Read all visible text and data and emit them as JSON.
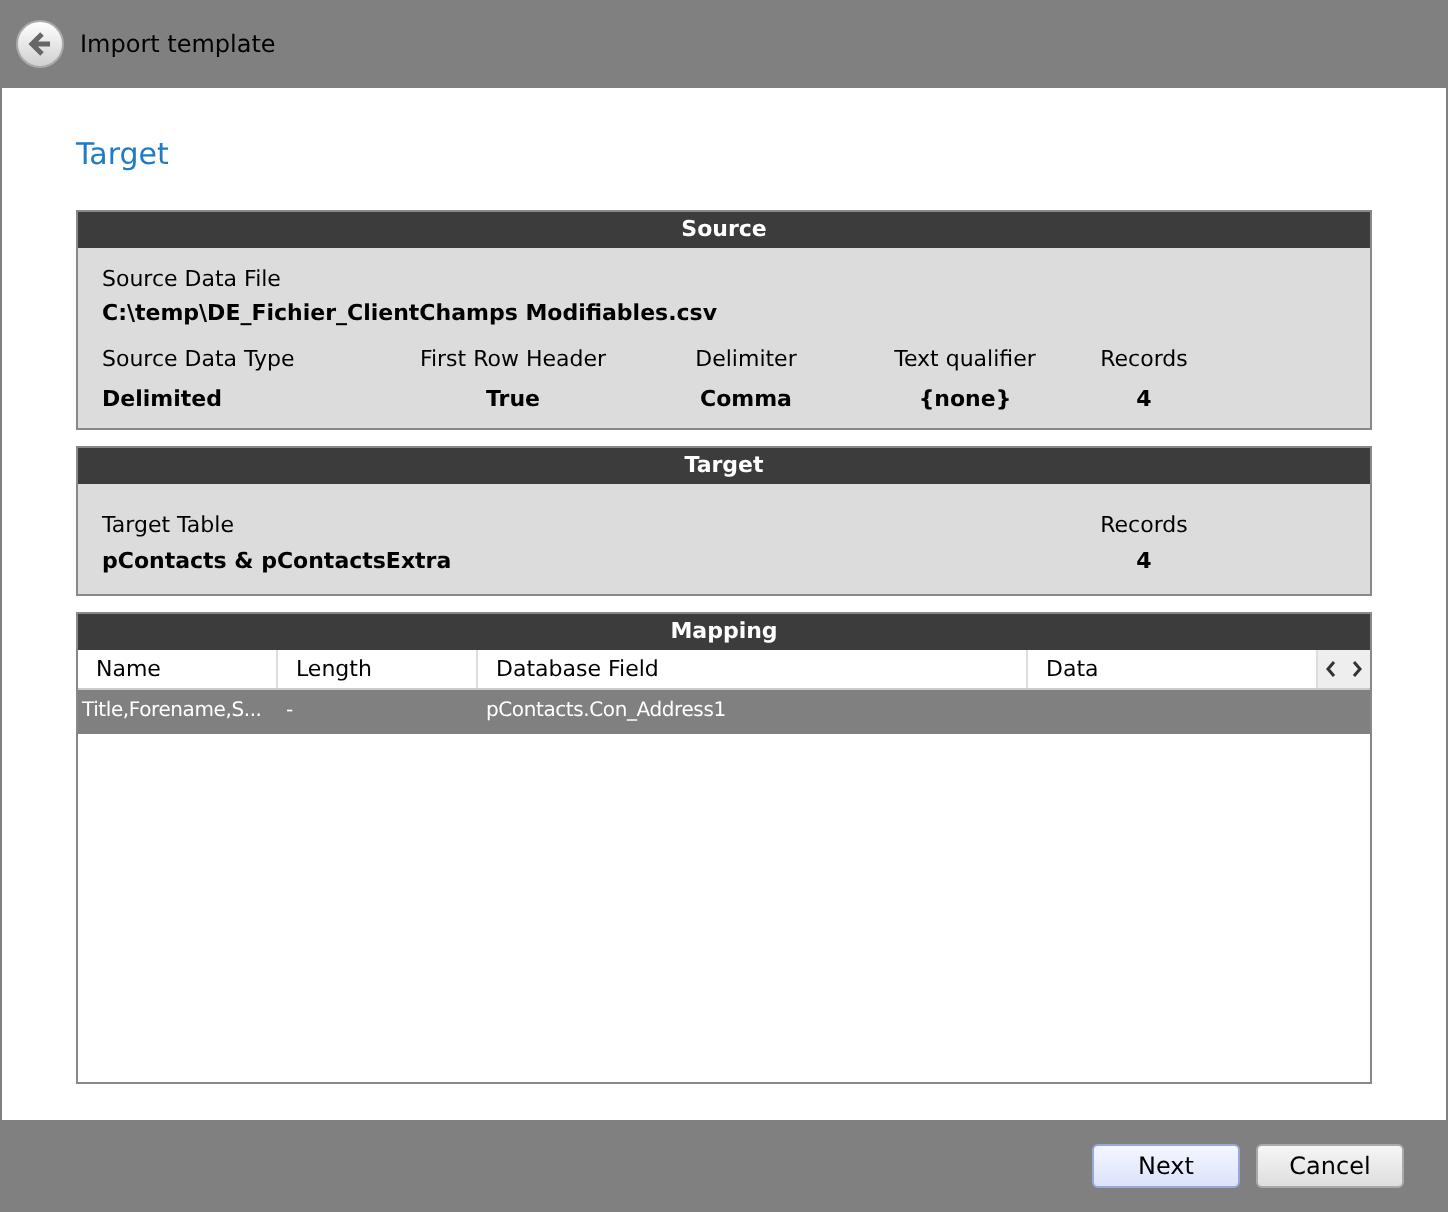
{
  "window": {
    "title": "Import template"
  },
  "page_title": "Target",
  "source": {
    "title": "Source",
    "file_label": "Source Data File",
    "file_value": "C:\\temp\\DE_Fichier_ClientChamps Modifiables.csv",
    "fields": [
      {
        "label": "Source Data Type",
        "value": "Delimited"
      },
      {
        "label": "First Row Header",
        "value": "True"
      },
      {
        "label": "Delimiter",
        "value": "Comma"
      },
      {
        "label": "Text qualifier",
        "value": "{none}"
      },
      {
        "label": "Records",
        "value": "4"
      }
    ]
  },
  "target": {
    "title": "Target",
    "table_label": "Target Table",
    "table_value": "pContacts & pContactsExtra",
    "records_label": "Records",
    "records_value": "4"
  },
  "mapping": {
    "title": "Mapping",
    "columns": [
      "Name",
      "Length",
      "Database Field",
      "Data"
    ],
    "rows": [
      {
        "cells": [
          "Title,Forename,S...",
          "-",
          "pContacts.Con_Address1",
          ""
        ],
        "selected": true
      }
    ]
  },
  "buttons": [
    {
      "label": "Next",
      "kind": "primary"
    },
    {
      "label": "Cancel",
      "kind": "secondary"
    }
  ]
}
